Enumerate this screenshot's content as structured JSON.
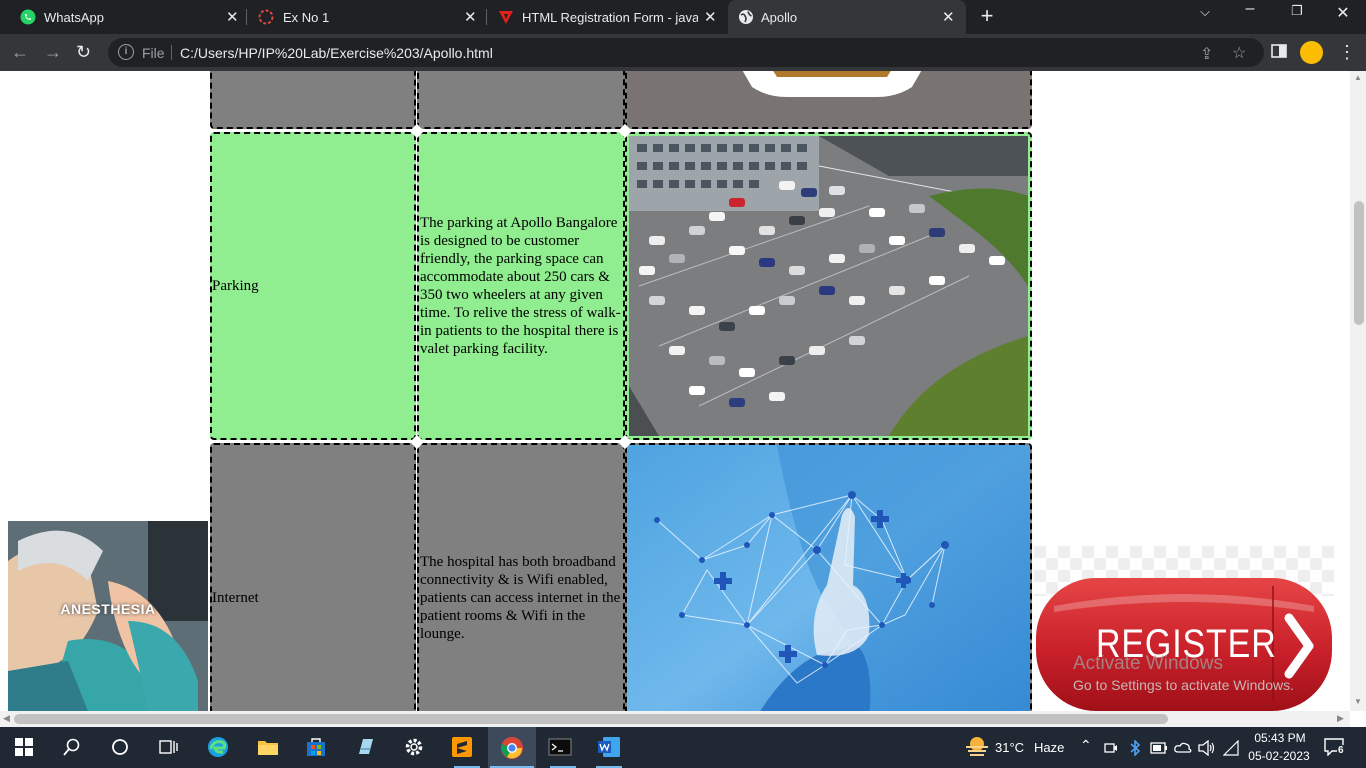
{
  "browser": {
    "tabs": [
      {
        "title": "WhatsApp",
        "icon": "whatsapp-icon"
      },
      {
        "title": "Ex No 1",
        "icon": "loading-icon"
      },
      {
        "title": "HTML Registration Form - javatpoint",
        "icon": "javatpoint-icon"
      },
      {
        "title": "Apollo",
        "icon": "globe-icon",
        "active": true
      }
    ],
    "address": {
      "scheme_label": "File",
      "url": "C:/Users/HP/IP%20Lab/Exercise%203/Apollo.html"
    }
  },
  "table": {
    "rows": [
      {
        "facility": "",
        "description": "",
        "image": "food-dish",
        "bg": "#808080"
      },
      {
        "facility": "Parking",
        "description": "The parking at Apollo Bangalore is designed to be customer friendly, the parking space can accommodate about 250 cars & 350 two wheelers at any given time. To relive the stress of walk-in patients to the hospital there is valet parking facility.",
        "image": "parking-lot",
        "bg": "#90ee90"
      },
      {
        "facility": "Internet",
        "description": "The hospital has both broadband connectivity & is Wifi enabled, patients can access internet in the patient rooms & Wifi in the lounge.",
        "image": "medical-network",
        "bg": "#808080"
      }
    ]
  },
  "side_ad": {
    "text": "ANESTHESIA"
  },
  "register_button": {
    "label": "REGISTER"
  },
  "watermark": {
    "line1": "Activate Windows",
    "line2": "Go to Settings to activate Windows."
  },
  "taskbar": {
    "weather": {
      "temp": "31°C",
      "condition": "Haze"
    },
    "time": "05:43 PM",
    "date": "05-02-2023",
    "notifications": "6"
  }
}
